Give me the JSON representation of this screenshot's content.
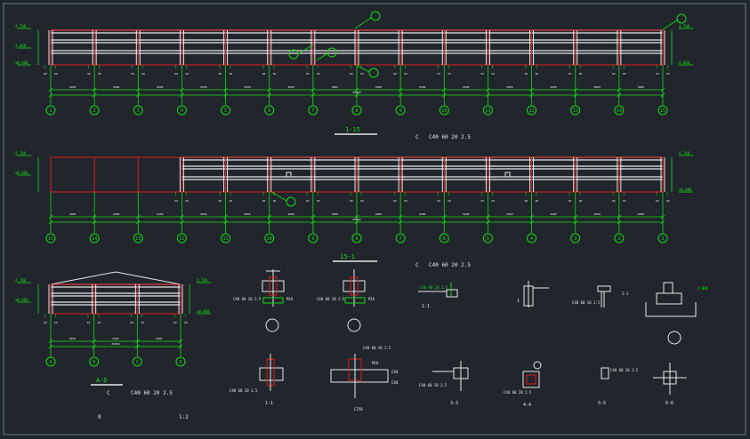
{
  "colors": {
    "background": "#21262c",
    "frame": "#6c7a86",
    "white": "#e8e8e8",
    "red": "#e01b1b",
    "green": "#18d818",
    "cyan": "#3fd0e0",
    "yellow": "#e6e04a"
  },
  "elevation1": {
    "axes": [
      "1",
      "2",
      "3",
      "4",
      "5",
      "6",
      "7",
      "8",
      "9",
      "10",
      "11",
      "12",
      "13",
      "14",
      "15"
    ],
    "title": "1-15",
    "left_dims": [
      "4.700",
      "4.000",
      "±0.000"
    ],
    "right_dims": [
      "4.700",
      "4.000"
    ]
  },
  "note1": {
    "mark": "C",
    "text": "C40 60 20 2.5"
  },
  "elevation2": {
    "axes": [
      "15",
      "14",
      "13",
      "12",
      "11",
      "10",
      "9",
      "8",
      "7",
      "6",
      "5",
      "4",
      "3",
      "2",
      "1"
    ],
    "left_dims": [
      "4.700",
      "±0.000"
    ],
    "right_dims": [
      "4.700",
      "±0.000"
    ]
  },
  "note2": {
    "mark": "C",
    "text": "C40 60 20 2.5"
  },
  "section_title": "15-1",
  "elevation3": {
    "axes": [
      "A",
      "B",
      "C",
      "D"
    ],
    "title": "A-D",
    "left_dims": [
      "4.700",
      "±0.000"
    ],
    "right_dims": [
      "4.700",
      "±0.000"
    ]
  },
  "note3": {
    "mark": "C",
    "text": "C40 60 20 2.5"
  },
  "bottom_marks": {
    "left": "8",
    "right": "1:2"
  },
  "details": {
    "d1": {
      "callout": "C40 60 20 2.5",
      "note": "M16"
    },
    "d2": {
      "callout": "C40 60 20 2.5",
      "note": "M16"
    },
    "d3": {
      "callout": "C40 60 20 2.5",
      "label": "1-1"
    },
    "d4": {
      "label": "1"
    },
    "d5": {
      "callout": "C40 60 20 2.5",
      "label": "2-1"
    },
    "d6": {
      "note": "4.000"
    },
    "d7": {
      "callout": "C40 60 20 2.5",
      "label": "1-1"
    },
    "d8": {
      "callout": "C40 60 20 2.5",
      "labels": [
        "M16",
        "C40",
        "C40"
      ],
      "sublabel": "C250"
    },
    "d9": {
      "callout": "C40 60 20 2.5",
      "label": "3-3"
    },
    "d10": {
      "callout": "C40 60 20 2.5",
      "label": "4-4"
    },
    "d11": {
      "callout": "C40 60 20 2.5",
      "label": "5-5"
    },
    "d12": {
      "label": "6-6"
    }
  }
}
